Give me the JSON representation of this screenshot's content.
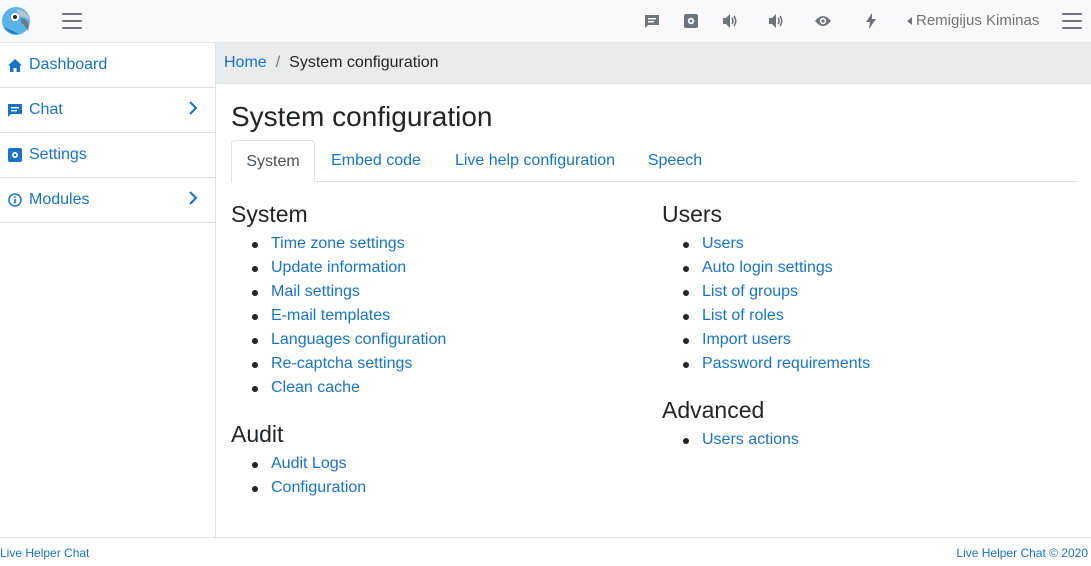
{
  "topbar": {
    "user_name": "Remigijus Kiminas",
    "icons": [
      "logo-parrot-icon",
      "menu-icon",
      "chat-icon",
      "settings-icon",
      "sound-icon",
      "sound-icon-2",
      "eye-icon",
      "flash-icon",
      "caret-left-icon",
      "menu-icon-right"
    ]
  },
  "sidebar": {
    "items": [
      {
        "label": "Dashboard",
        "icon": "home-icon",
        "has_children": false
      },
      {
        "label": "Chat",
        "icon": "chat-icon",
        "has_children": true
      },
      {
        "label": "Settings",
        "icon": "settings-icon",
        "has_children": false
      },
      {
        "label": "Modules",
        "icon": "info-icon",
        "has_children": true
      }
    ]
  },
  "breadcrumb": {
    "home": "Home",
    "separator": "/",
    "current": "System configuration"
  },
  "page": {
    "title": "System configuration"
  },
  "tabs": [
    {
      "label": "System",
      "active": true
    },
    {
      "label": "Embed code",
      "active": false
    },
    {
      "label": "Live help configuration",
      "active": false
    },
    {
      "label": "Speech",
      "active": false
    }
  ],
  "sections": {
    "system": {
      "title": "System",
      "links": [
        "Time zone settings",
        "Update information",
        "Mail settings",
        "E-mail templates",
        "Languages configuration",
        "Re-captcha settings",
        "Clean cache"
      ]
    },
    "audit": {
      "title": "Audit",
      "links": [
        "Audit Logs",
        "Configuration"
      ]
    },
    "users": {
      "title": "Users",
      "links": [
        "Users",
        "Auto login settings",
        "List of groups",
        "List of roles",
        "Import users",
        "Password requirements"
      ]
    },
    "advanced": {
      "title": "Advanced",
      "links": [
        "Users actions"
      ]
    }
  },
  "footer": {
    "left": "Live Helper Chat",
    "right": "Live Helper Chat © 2020"
  },
  "colors": {
    "link": "#1a73c8",
    "text": "#212529",
    "muted": "#6c757d",
    "breadcrumb_bg": "#e9ecef",
    "topbar_bg": "#f8f9fa"
  }
}
